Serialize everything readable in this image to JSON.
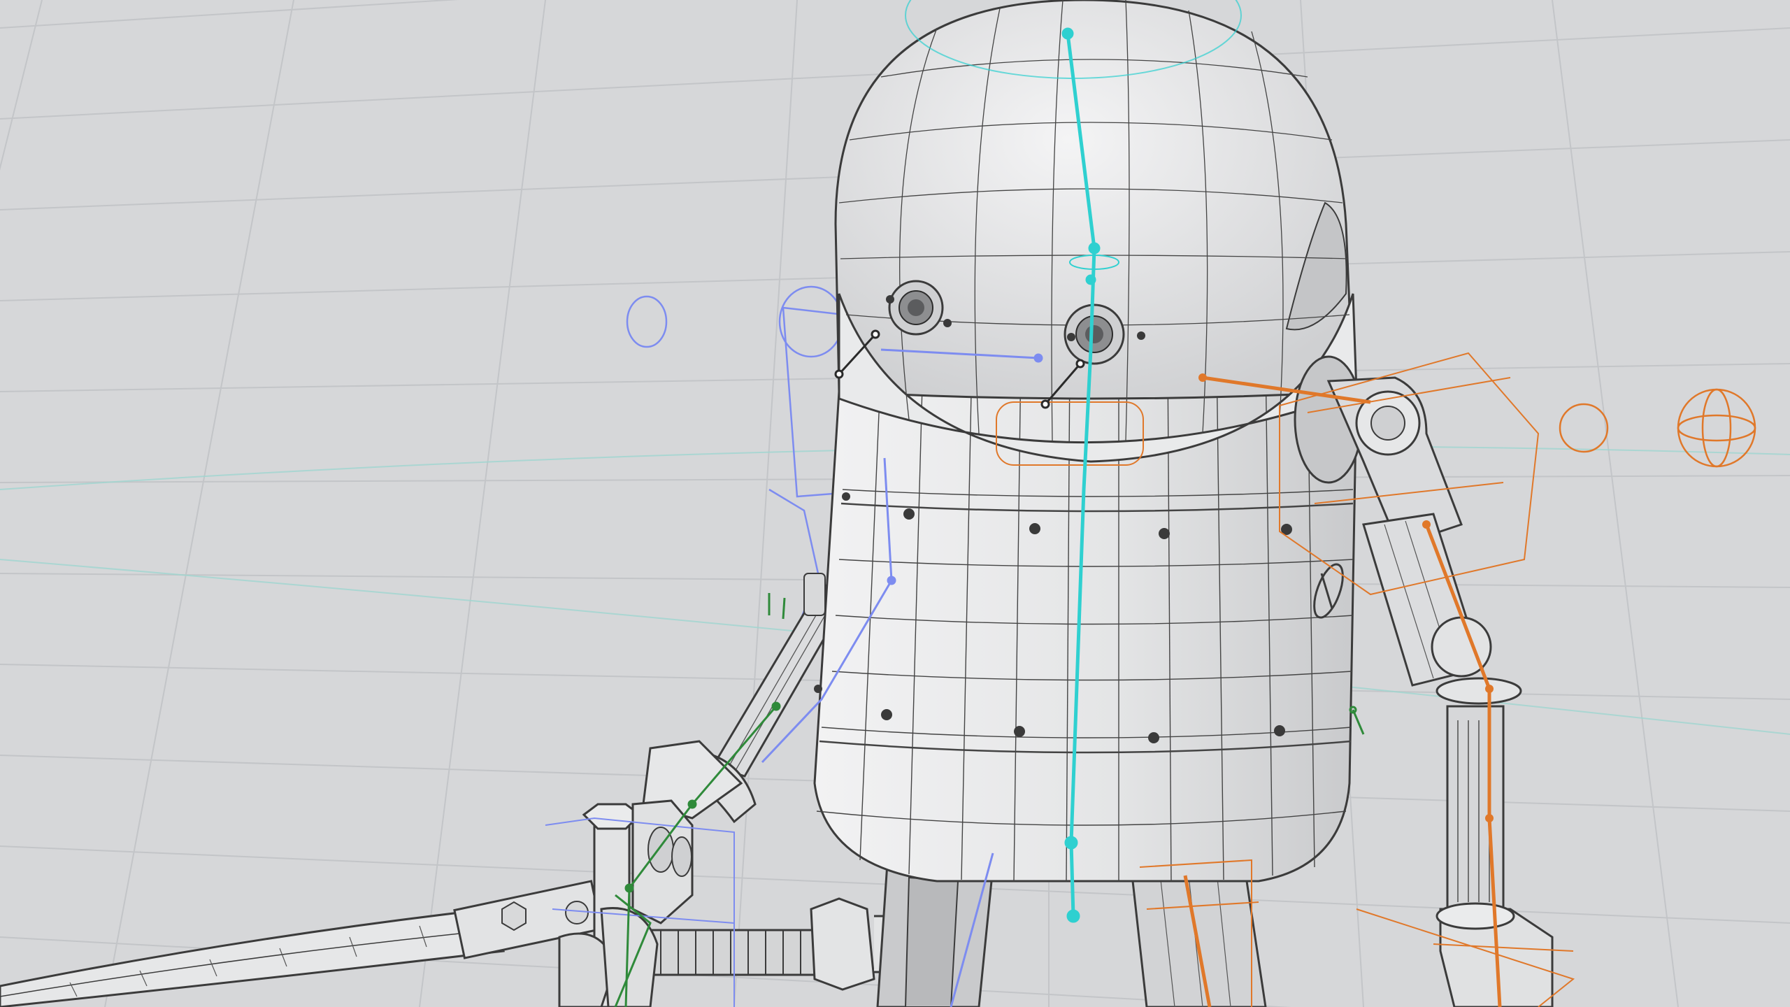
{
  "viewport": {
    "description_name": "3d-wireframe-viewport",
    "colors": {
      "background": "#d6d7d9",
      "grid": "#c3c5c8",
      "horizon_guide": "#9fd6d0",
      "mesh_fill": "#e8e9ea",
      "mesh_wire": "#3b3b3b",
      "spine_bone": "#2fd0d0",
      "left_rig": "#7d8cf0",
      "right_rig": "#e0782a",
      "hand_rig": "#2f8a3a"
    },
    "scene": {
      "subject": "robot-character",
      "shading": "wireframe-on-shaded"
    }
  }
}
